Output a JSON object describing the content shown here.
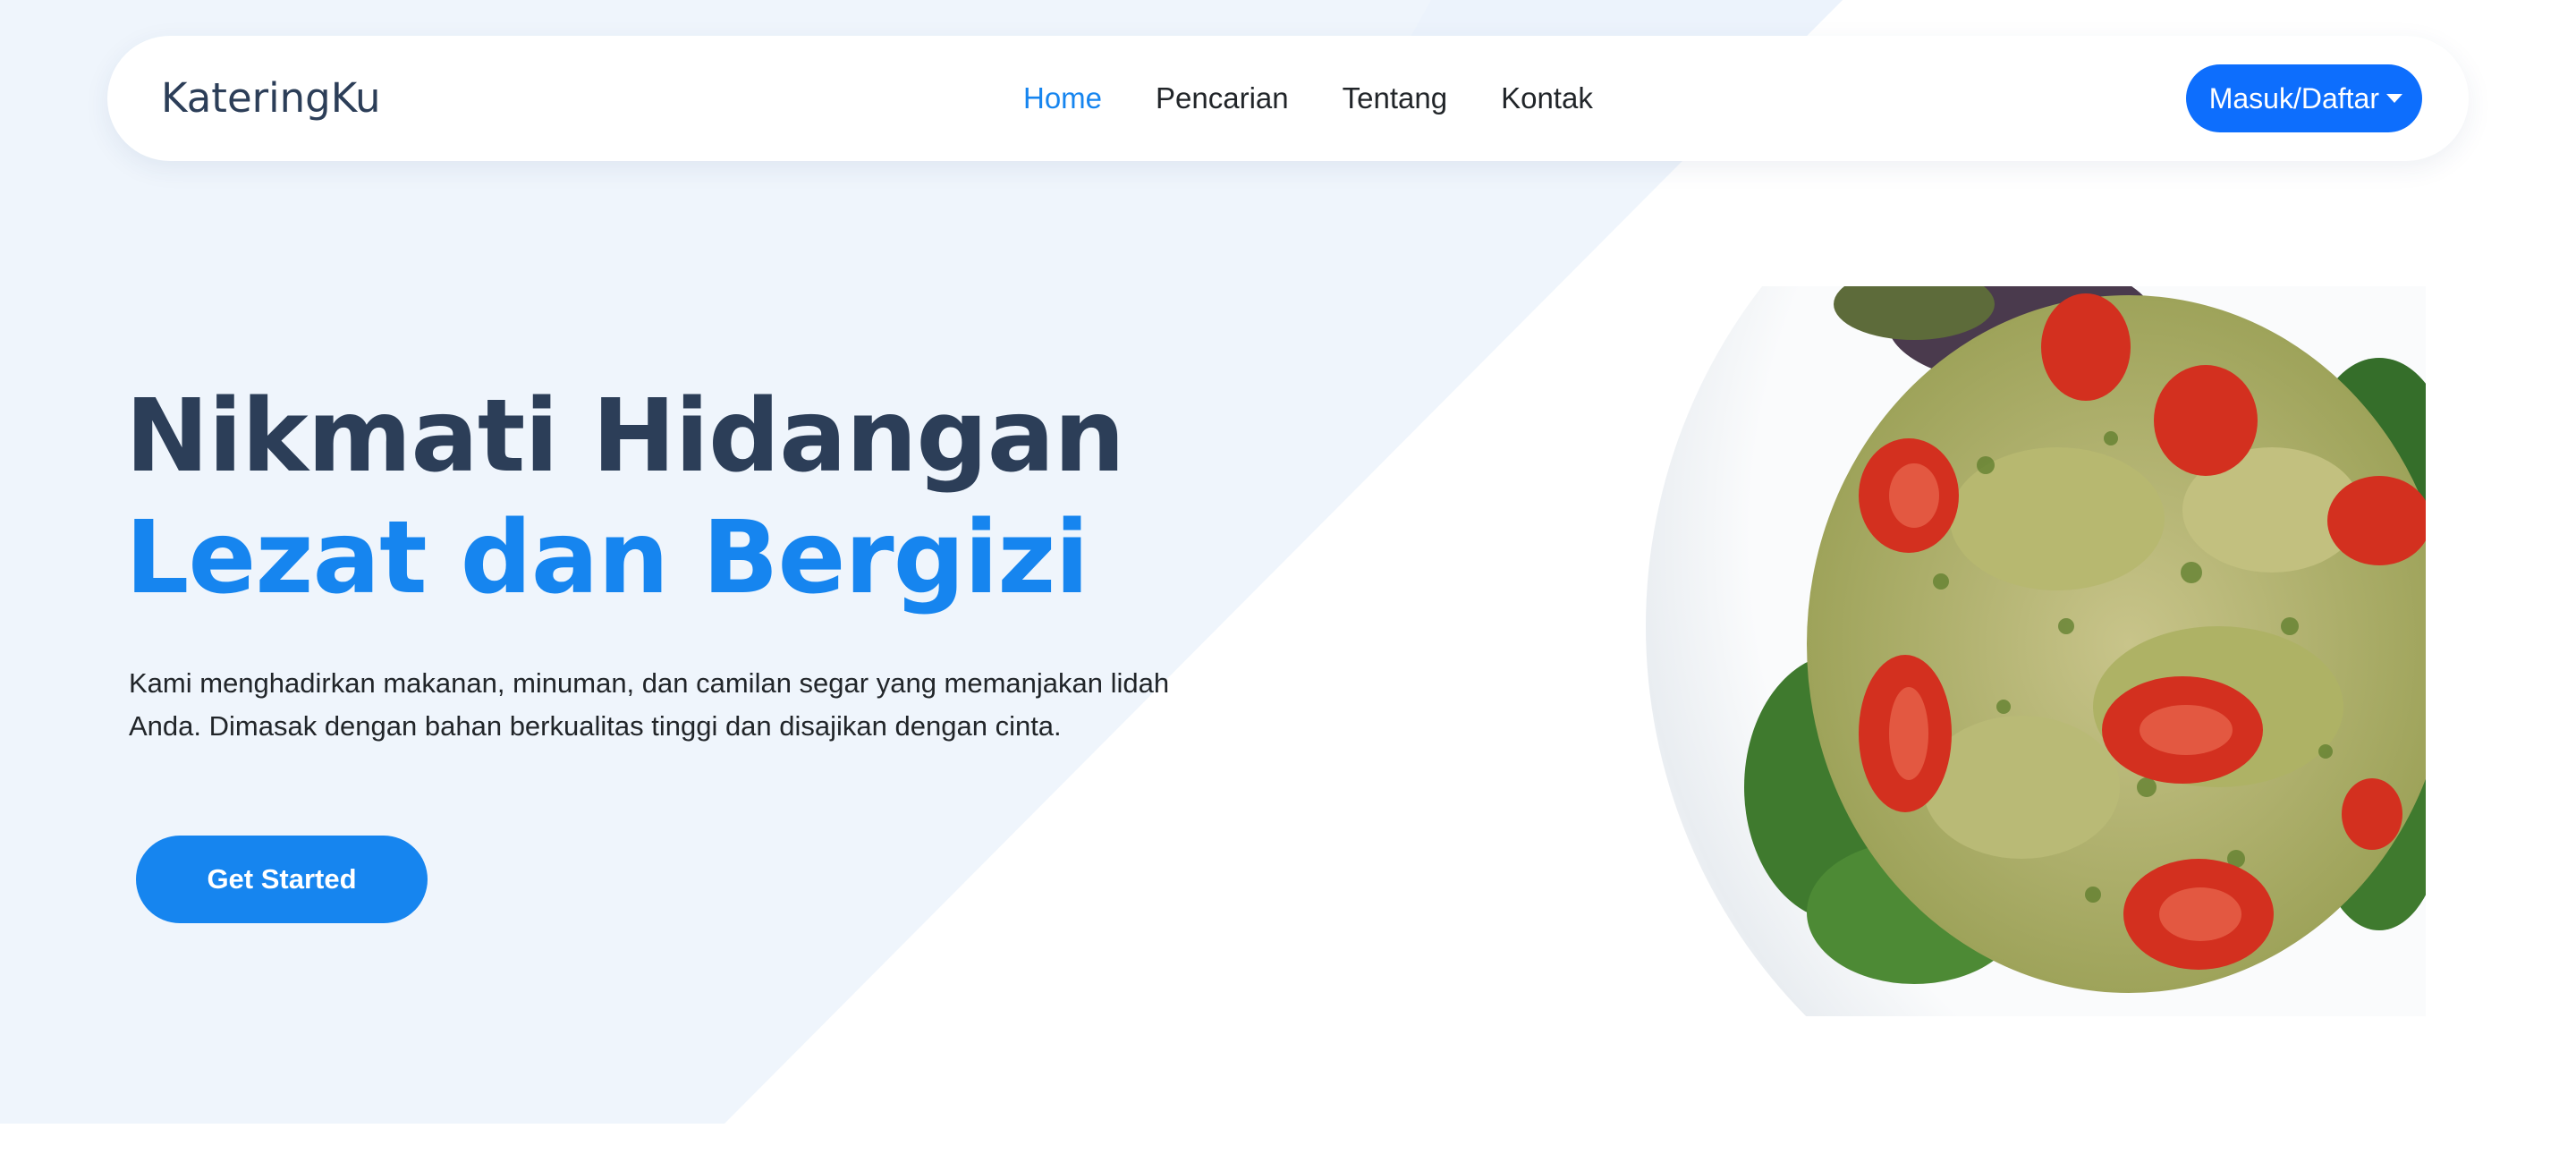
{
  "brand": {
    "name": "KateringKu"
  },
  "nav": {
    "items": [
      {
        "label": "Home",
        "active": true
      },
      {
        "label": "Pencarian",
        "active": false
      },
      {
        "label": "Tentang",
        "active": false
      },
      {
        "label": "Kontak",
        "active": false
      }
    ],
    "login_label": "Masuk/Daftar"
  },
  "hero": {
    "title_line1": "Nikmati Hidangan",
    "title_line2": "Lezat dan Bergizi",
    "description": "Kami menghadirkan makanan, minuman, dan camilan segar yang memanjakan lidah Anda. Dimasak dengan bahan berkualitas tinggi dan disajikan dengan cinta.",
    "cta_label": "Get Started",
    "image_icon": "pasta-salad-plate-image"
  },
  "colors": {
    "accent": "#1685ef",
    "primary_button": "#0d6efd",
    "heading_dark": "#2c3e58",
    "hero_background": "#eff5fc"
  }
}
